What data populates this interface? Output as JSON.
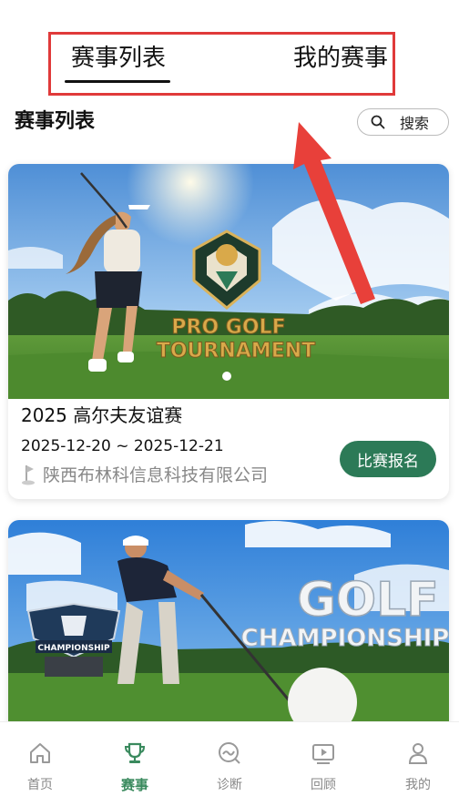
{
  "top_tabs": {
    "event_list": "赛事列表",
    "my_events": "我的赛事"
  },
  "section": {
    "title": "赛事列表",
    "search_label": "搜索"
  },
  "cards": [
    {
      "poster_text_line1": "PRO GOLF",
      "poster_text_line2": "TOURNAMENT",
      "title": "2025 高尔夫友谊赛",
      "date_range": "2025-12-20 ~ 2025-12-21",
      "organizer": "陕西布林科信息科技有限公司",
      "signup_label": "比赛报名"
    },
    {
      "poster_text_line1": "GOLF",
      "poster_text_line2": "CHAMPIONSHIP",
      "badge_text": "CHAMPIONSHIP"
    }
  ],
  "bottom_nav": {
    "home": "首页",
    "events": "赛事",
    "diagnose": "诊断",
    "review": "回顾",
    "me": "我的"
  },
  "colors": {
    "accent_green": "#2c7a57",
    "nav_active": "#3a8a5e",
    "highlight_red": "#e03a3a"
  }
}
